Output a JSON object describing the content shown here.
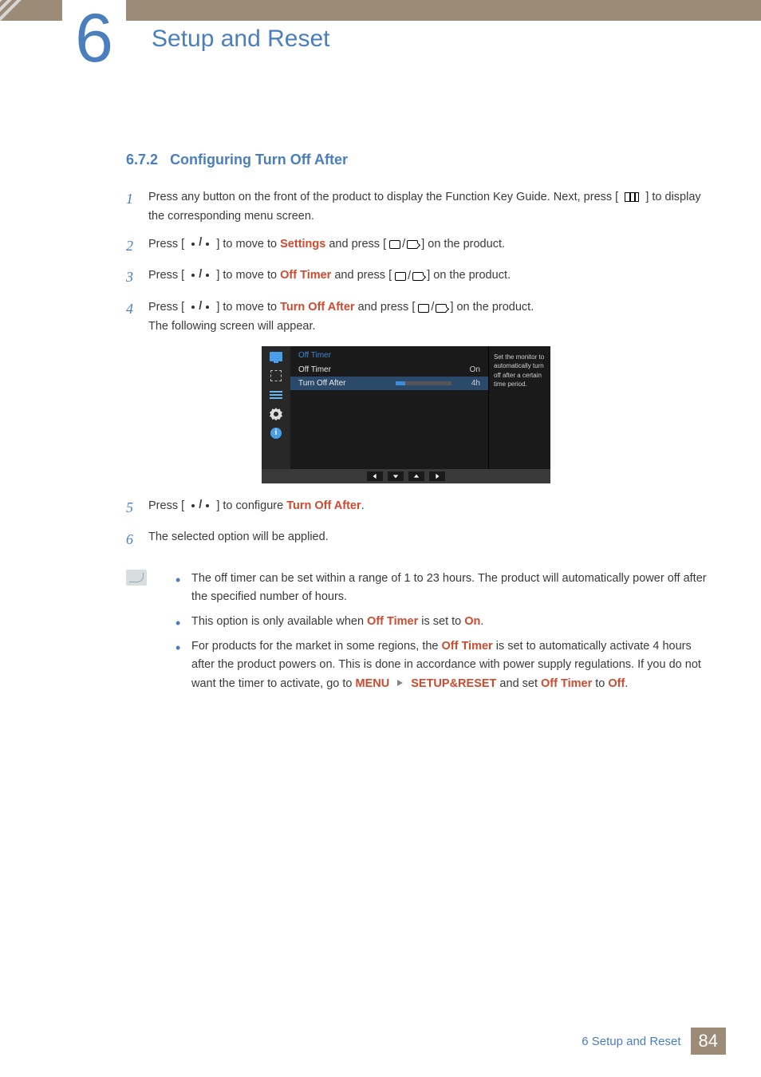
{
  "chapter": {
    "number": "6",
    "title": "Setup and Reset"
  },
  "section": {
    "number": "6.7.2",
    "title": "Configuring Turn Off After"
  },
  "steps": {
    "s1": {
      "num": "1",
      "p1": "Press any button on the front of the product to display the Function Key Guide. Next, press [",
      "p2": "] to display the corresponding menu screen."
    },
    "s2": {
      "num": "2",
      "p1": "Press [",
      "p2": "] to move to ",
      "kw": "Settings",
      "p3": " and press [",
      "p4": "] on the product."
    },
    "s3": {
      "num": "3",
      "p1": "Press [",
      "p2": "] to move to ",
      "kw": "Off Timer",
      "p3": " and press [",
      "p4": "] on the product."
    },
    "s4": {
      "num": "4",
      "p1": "Press [",
      "p2": "] to move to ",
      "kw": "Turn Off After",
      "p3": " and press [",
      "p4": "] on the product.",
      "tail": "The following screen will appear."
    },
    "s5": {
      "num": "5",
      "p1": "Press [",
      "p2": "] to configure ",
      "kw": "Turn Off After",
      "p3": "."
    },
    "s6": {
      "num": "6",
      "body": "The selected option will be applied."
    }
  },
  "osd": {
    "title": "Off Timer",
    "row1": {
      "label": "Off Timer",
      "value": "On"
    },
    "row2": {
      "label": "Turn Off After",
      "value": "4h"
    },
    "help": "Set the monitor to automatically turn off after a certain time period.",
    "info_glyph": "i"
  },
  "notes": {
    "n1": "The off timer can be set within a range of 1 to 23 hours. The product will automatically power off after the specified number of hours.",
    "n2": {
      "p1": "This option is only available when ",
      "kw1": "Off Timer",
      "p2": " is set to ",
      "kw2": "On",
      "p3": "."
    },
    "n3": {
      "p1": "For products for the market in some regions, the ",
      "kw1": "Off Timer",
      "p2": " is set to automatically activate 4 hours after the product powers on. This is done in accordance with power supply regulations. If you do not want the timer to activate, go to ",
      "kw2": "MENU",
      "kw3": "SETUP&RESET",
      "p3": " and set ",
      "kw4": "Off Timer",
      "p4": " to ",
      "kw5": "Off",
      "p5": "."
    }
  },
  "footer": {
    "text": "6 Setup and Reset",
    "page": "84"
  }
}
